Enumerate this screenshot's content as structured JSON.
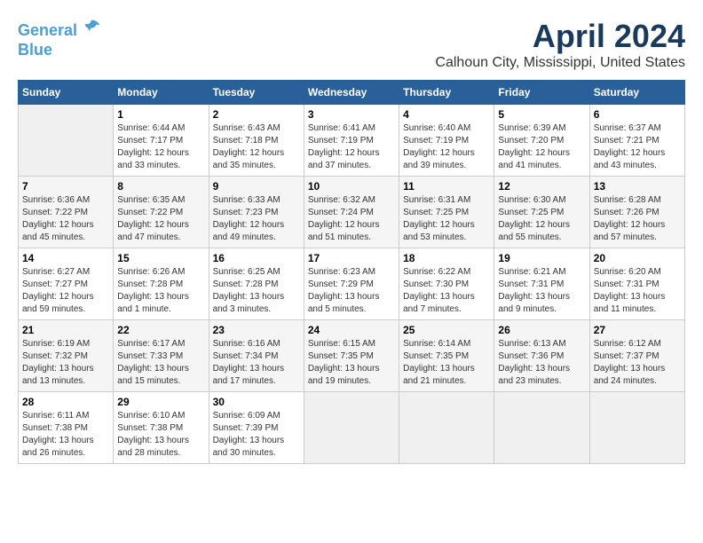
{
  "logo": {
    "line1": "General",
    "line2": "Blue"
  },
  "title": "April 2024",
  "subtitle": "Calhoun City, Mississippi, United States",
  "days_header": [
    "Sunday",
    "Monday",
    "Tuesday",
    "Wednesday",
    "Thursday",
    "Friday",
    "Saturday"
  ],
  "weeks": [
    [
      {
        "num": "",
        "sunrise": "",
        "sunset": "",
        "daylight": ""
      },
      {
        "num": "1",
        "sunrise": "Sunrise: 6:44 AM",
        "sunset": "Sunset: 7:17 PM",
        "daylight": "Daylight: 12 hours and 33 minutes."
      },
      {
        "num": "2",
        "sunrise": "Sunrise: 6:43 AM",
        "sunset": "Sunset: 7:18 PM",
        "daylight": "Daylight: 12 hours and 35 minutes."
      },
      {
        "num": "3",
        "sunrise": "Sunrise: 6:41 AM",
        "sunset": "Sunset: 7:19 PM",
        "daylight": "Daylight: 12 hours and 37 minutes."
      },
      {
        "num": "4",
        "sunrise": "Sunrise: 6:40 AM",
        "sunset": "Sunset: 7:19 PM",
        "daylight": "Daylight: 12 hours and 39 minutes."
      },
      {
        "num": "5",
        "sunrise": "Sunrise: 6:39 AM",
        "sunset": "Sunset: 7:20 PM",
        "daylight": "Daylight: 12 hours and 41 minutes."
      },
      {
        "num": "6",
        "sunrise": "Sunrise: 6:37 AM",
        "sunset": "Sunset: 7:21 PM",
        "daylight": "Daylight: 12 hours and 43 minutes."
      }
    ],
    [
      {
        "num": "7",
        "sunrise": "Sunrise: 6:36 AM",
        "sunset": "Sunset: 7:22 PM",
        "daylight": "Daylight: 12 hours and 45 minutes."
      },
      {
        "num": "8",
        "sunrise": "Sunrise: 6:35 AM",
        "sunset": "Sunset: 7:22 PM",
        "daylight": "Daylight: 12 hours and 47 minutes."
      },
      {
        "num": "9",
        "sunrise": "Sunrise: 6:33 AM",
        "sunset": "Sunset: 7:23 PM",
        "daylight": "Daylight: 12 hours and 49 minutes."
      },
      {
        "num": "10",
        "sunrise": "Sunrise: 6:32 AM",
        "sunset": "Sunset: 7:24 PM",
        "daylight": "Daylight: 12 hours and 51 minutes."
      },
      {
        "num": "11",
        "sunrise": "Sunrise: 6:31 AM",
        "sunset": "Sunset: 7:25 PM",
        "daylight": "Daylight: 12 hours and 53 minutes."
      },
      {
        "num": "12",
        "sunrise": "Sunrise: 6:30 AM",
        "sunset": "Sunset: 7:25 PM",
        "daylight": "Daylight: 12 hours and 55 minutes."
      },
      {
        "num": "13",
        "sunrise": "Sunrise: 6:28 AM",
        "sunset": "Sunset: 7:26 PM",
        "daylight": "Daylight: 12 hours and 57 minutes."
      }
    ],
    [
      {
        "num": "14",
        "sunrise": "Sunrise: 6:27 AM",
        "sunset": "Sunset: 7:27 PM",
        "daylight": "Daylight: 12 hours and 59 minutes."
      },
      {
        "num": "15",
        "sunrise": "Sunrise: 6:26 AM",
        "sunset": "Sunset: 7:28 PM",
        "daylight": "Daylight: 13 hours and 1 minute."
      },
      {
        "num": "16",
        "sunrise": "Sunrise: 6:25 AM",
        "sunset": "Sunset: 7:28 PM",
        "daylight": "Daylight: 13 hours and 3 minutes."
      },
      {
        "num": "17",
        "sunrise": "Sunrise: 6:23 AM",
        "sunset": "Sunset: 7:29 PM",
        "daylight": "Daylight: 13 hours and 5 minutes."
      },
      {
        "num": "18",
        "sunrise": "Sunrise: 6:22 AM",
        "sunset": "Sunset: 7:30 PM",
        "daylight": "Daylight: 13 hours and 7 minutes."
      },
      {
        "num": "19",
        "sunrise": "Sunrise: 6:21 AM",
        "sunset": "Sunset: 7:31 PM",
        "daylight": "Daylight: 13 hours and 9 minutes."
      },
      {
        "num": "20",
        "sunrise": "Sunrise: 6:20 AM",
        "sunset": "Sunset: 7:31 PM",
        "daylight": "Daylight: 13 hours and 11 minutes."
      }
    ],
    [
      {
        "num": "21",
        "sunrise": "Sunrise: 6:19 AM",
        "sunset": "Sunset: 7:32 PM",
        "daylight": "Daylight: 13 hours and 13 minutes."
      },
      {
        "num": "22",
        "sunrise": "Sunrise: 6:17 AM",
        "sunset": "Sunset: 7:33 PM",
        "daylight": "Daylight: 13 hours and 15 minutes."
      },
      {
        "num": "23",
        "sunrise": "Sunrise: 6:16 AM",
        "sunset": "Sunset: 7:34 PM",
        "daylight": "Daylight: 13 hours and 17 minutes."
      },
      {
        "num": "24",
        "sunrise": "Sunrise: 6:15 AM",
        "sunset": "Sunset: 7:35 PM",
        "daylight": "Daylight: 13 hours and 19 minutes."
      },
      {
        "num": "25",
        "sunrise": "Sunrise: 6:14 AM",
        "sunset": "Sunset: 7:35 PM",
        "daylight": "Daylight: 13 hours and 21 minutes."
      },
      {
        "num": "26",
        "sunrise": "Sunrise: 6:13 AM",
        "sunset": "Sunset: 7:36 PM",
        "daylight": "Daylight: 13 hours and 23 minutes."
      },
      {
        "num": "27",
        "sunrise": "Sunrise: 6:12 AM",
        "sunset": "Sunset: 7:37 PM",
        "daylight": "Daylight: 13 hours and 24 minutes."
      }
    ],
    [
      {
        "num": "28",
        "sunrise": "Sunrise: 6:11 AM",
        "sunset": "Sunset: 7:38 PM",
        "daylight": "Daylight: 13 hours and 26 minutes."
      },
      {
        "num": "29",
        "sunrise": "Sunrise: 6:10 AM",
        "sunset": "Sunset: 7:38 PM",
        "daylight": "Daylight: 13 hours and 28 minutes."
      },
      {
        "num": "30",
        "sunrise": "Sunrise: 6:09 AM",
        "sunset": "Sunset: 7:39 PM",
        "daylight": "Daylight: 13 hours and 30 minutes."
      },
      {
        "num": "",
        "sunrise": "",
        "sunset": "",
        "daylight": ""
      },
      {
        "num": "",
        "sunrise": "",
        "sunset": "",
        "daylight": ""
      },
      {
        "num": "",
        "sunrise": "",
        "sunset": "",
        "daylight": ""
      },
      {
        "num": "",
        "sunrise": "",
        "sunset": "",
        "daylight": ""
      }
    ]
  ]
}
